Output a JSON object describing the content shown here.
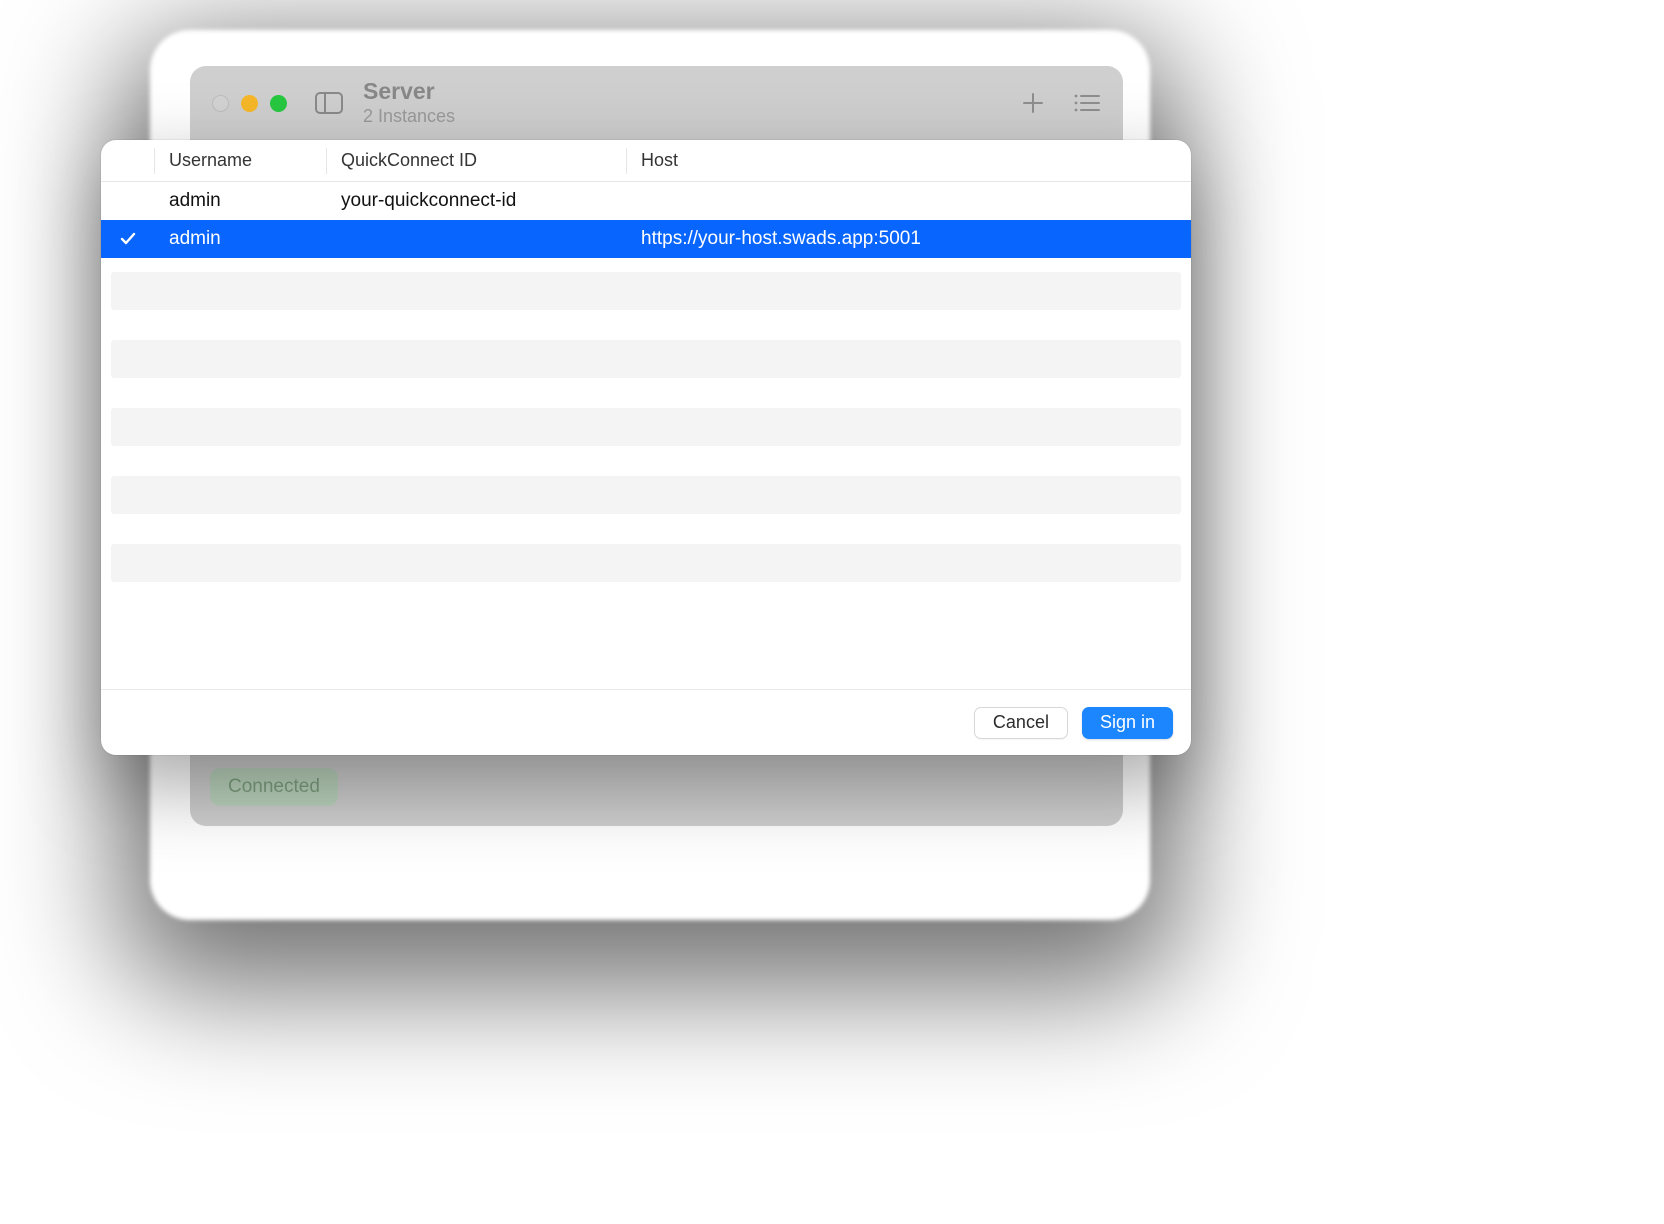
{
  "window": {
    "title": "Server",
    "subtitle": "2 Instances",
    "status_badge": "Connected"
  },
  "sheet": {
    "columns": {
      "username": "Username",
      "quickconnect": "QuickConnect ID",
      "host": "Host"
    },
    "rows": [
      {
        "selected": false,
        "username": "admin",
        "quickconnect": "your-quickconnect-id",
        "host": ""
      },
      {
        "selected": true,
        "username": "admin",
        "quickconnect": "",
        "host": "https://your-host.swads.app:5001"
      }
    ],
    "buttons": {
      "cancel": "Cancel",
      "signin": "Sign in"
    }
  }
}
